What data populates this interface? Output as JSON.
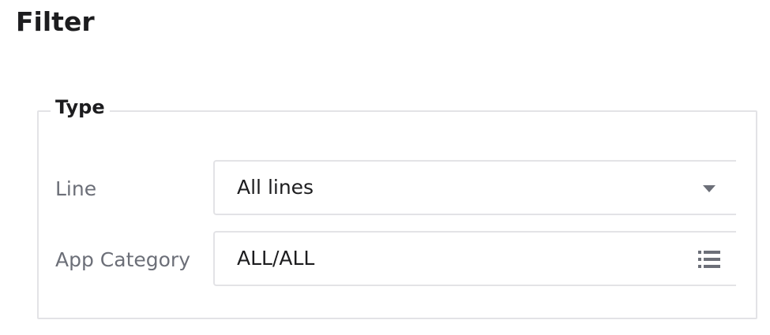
{
  "page": {
    "title": "Filter"
  },
  "type_group": {
    "legend": "Type",
    "line": {
      "label": "Line",
      "value": "All lines",
      "icon": "caret-down-icon"
    },
    "app_category": {
      "label": "App Category",
      "value": "ALL/ALL",
      "icon": "list-icon"
    }
  },
  "colors": {
    "text": "#1d1d1f",
    "label": "#6c6f78",
    "border": "#e3e3e6",
    "icon": "#6c6f78"
  }
}
